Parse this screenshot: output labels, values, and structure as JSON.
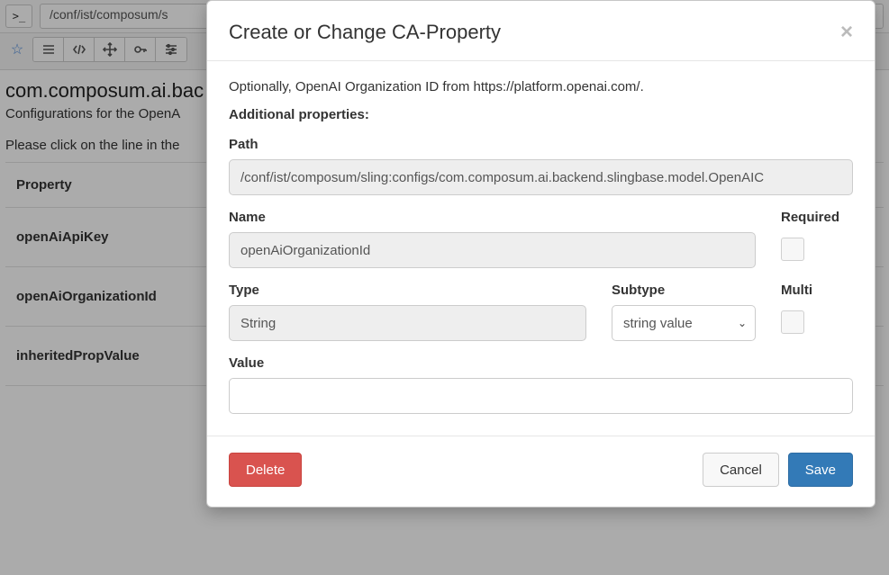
{
  "topbar": {
    "path_display": "/conf/ist/composum/s"
  },
  "heading": {
    "title": "com.composum.ai.bac",
    "line1": "Configurations for the OpenA",
    "line2": "Please click on the line in the"
  },
  "table": {
    "header_property": "Property",
    "rows": [
      {
        "property": "openAiApiKey"
      },
      {
        "property": "openAiOrganizationId"
      },
      {
        "property": "inheritedPropValue"
      }
    ]
  },
  "modal": {
    "title": "Create or Change CA-Property",
    "caption": "Optionally, OpenAI Organization ID from https://platform.openai.com/.",
    "additional_properties_label": "Additional properties:",
    "labels": {
      "path": "Path",
      "name": "Name",
      "required": "Required",
      "type": "Type",
      "subtype": "Subtype",
      "multi": "Multi",
      "value": "Value"
    },
    "fields": {
      "path": "/conf/ist/composum/sling:configs/com.composum.ai.backend.slingbase.model.OpenAIC",
      "name": "openAiOrganizationId",
      "required": false,
      "type": "String",
      "subtype": "string value",
      "multi": false,
      "value": ""
    },
    "buttons": {
      "delete": "Delete",
      "cancel": "Cancel",
      "save": "Save"
    }
  }
}
